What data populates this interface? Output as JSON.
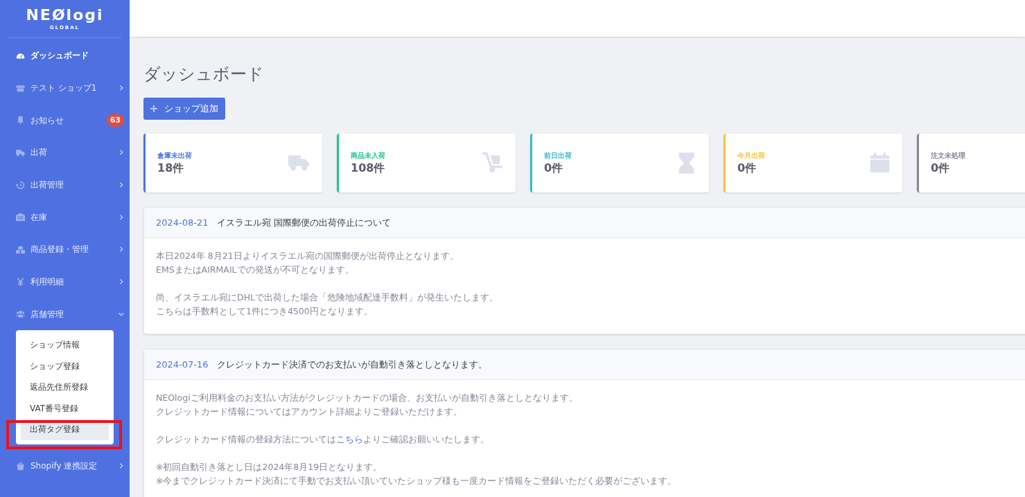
{
  "brand": {
    "name": "NEØlogi",
    "sub": "GLOBAL"
  },
  "sidebar": {
    "items": [
      {
        "label": "ダッシュボード",
        "active": true
      },
      {
        "label": "テスト ショップ1",
        "active": false,
        "expanded": false
      },
      {
        "label": "お知らせ",
        "active": false,
        "badge": "63"
      },
      {
        "label": "出荷",
        "active": false,
        "expanded": false
      },
      {
        "label": "出荷管理",
        "active": false,
        "expanded": false
      },
      {
        "label": "在庫",
        "active": false,
        "expanded": false
      },
      {
        "label": "商品登録・管理",
        "active": false,
        "expanded": false
      },
      {
        "label": "利用明細",
        "active": false,
        "expanded": false
      },
      {
        "label": "店舗管理",
        "active": false,
        "expanded": true,
        "children": [
          {
            "label": "ショップ情報",
            "selected": false
          },
          {
            "label": "ショップ登録",
            "selected": false
          },
          {
            "label": "返品先住所登録",
            "selected": false
          },
          {
            "label": "VAT番号登録",
            "selected": false
          },
          {
            "label": "出荷タグ登録",
            "selected": true
          }
        ]
      },
      {
        "label": "Shopify 連携設定",
        "active": false,
        "expanded": false
      }
    ]
  },
  "page_title": "ダッシュボード",
  "add_button": {
    "label": "ショップ追加"
  },
  "stats": [
    {
      "label": "倉庫未出荷",
      "value": "18件",
      "color": "#4e73df"
    },
    {
      "label": "商品未入荷",
      "value": "108件",
      "color": "#1cc88a"
    },
    {
      "label": "前日出荷",
      "value": "0件",
      "color": "#36b9cc"
    },
    {
      "label": "今月出荷",
      "value": "0件",
      "color": "#f6c23e"
    },
    {
      "label": "注文未処理",
      "value": "0件",
      "color": "#858796"
    }
  ],
  "notices": [
    {
      "date": "2024-08-21",
      "title": "イスラエル宛 国際郵便の出荷停止について",
      "paragraphs": [
        {
          "lines": [
            [
              {
                "text": "本日2024年 8月21日よりイスラエル宛の国際郵便が出荷停止となります。",
                "link": false
              }
            ],
            [
              {
                "text": "EMSまたはAIRMAILでの発送が不可となります。",
                "link": false
              }
            ]
          ]
        },
        {
          "lines": [
            [
              {
                "text": "尚、イスラエル宛にDHLで出荷した場合「危険地域配達手数料」が発生いたします。",
                "link": false
              }
            ],
            [
              {
                "text": "こちらは手数料として1件につき4500円となります。",
                "link": false
              }
            ]
          ]
        }
      ]
    },
    {
      "date": "2024-07-16",
      "title": "クレジットカード決済でのお支払いが自動引き落としとなります。",
      "paragraphs": [
        {
          "lines": [
            [
              {
                "text": "NEOlogiご利用料金のお支払い方法がクレジットカードの場合、お支払いが自動引き落としとなります。",
                "link": false
              }
            ],
            [
              {
                "text": "クレジットカード情報についてはアカウント詳細よりご登録いただけます。",
                "link": false
              }
            ]
          ]
        },
        {
          "lines": [
            [
              {
                "text": "クレジットカード情報の登録方法については",
                "link": false
              },
              {
                "text": "こちら",
                "link": true
              },
              {
                "text": "よりご確認お願いいたします。",
                "link": false
              }
            ]
          ]
        },
        {
          "lines": [
            [
              {
                "text": "※初回自動引き落とし日は2024年8月19日となります。",
                "link": false
              }
            ],
            [
              {
                "text": "※今までクレジットカード決済にて手動でお支払い頂いていたショップ様も一度カード情報をご登録いただく必要がございます。",
                "link": false
              }
            ]
          ]
        }
      ]
    }
  ]
}
